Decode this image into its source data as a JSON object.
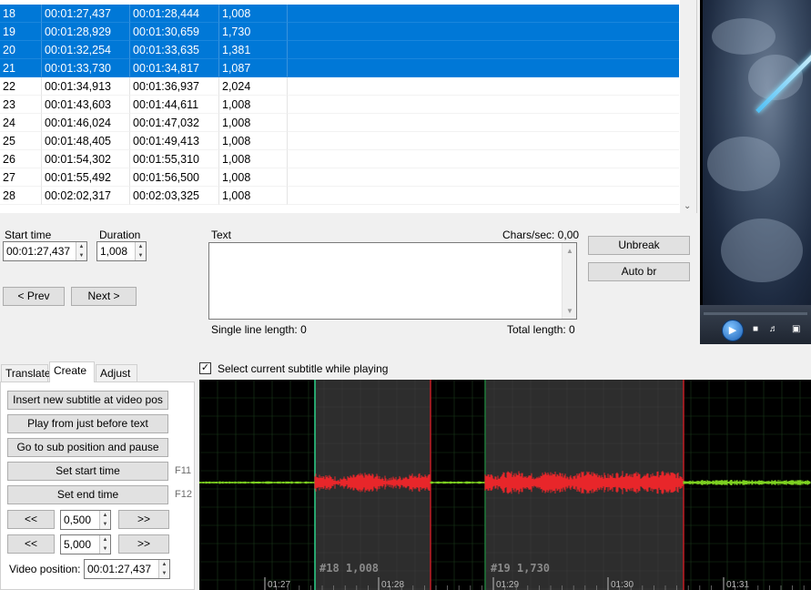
{
  "grid": {
    "rows": [
      {
        "num": "18",
        "start": "00:01:27,437",
        "end": "00:01:28,444",
        "dur": "1,008",
        "text": "",
        "selected": true
      },
      {
        "num": "19",
        "start": "00:01:28,929",
        "end": "00:01:30,659",
        "dur": "1,730",
        "text": "",
        "selected": true
      },
      {
        "num": "20",
        "start": "00:01:32,254",
        "end": "00:01:33,635",
        "dur": "1,381",
        "text": "",
        "selected": true
      },
      {
        "num": "21",
        "start": "00:01:33,730",
        "end": "00:01:34,817",
        "dur": "1,087",
        "text": "",
        "selected": true
      },
      {
        "num": "22",
        "start": "00:01:34,913",
        "end": "00:01:36,937",
        "dur": "2,024",
        "text": "",
        "selected": false
      },
      {
        "num": "23",
        "start": "00:01:43,603",
        "end": "00:01:44,611",
        "dur": "1,008",
        "text": "",
        "selected": false
      },
      {
        "num": "24",
        "start": "00:01:46,024",
        "end": "00:01:47,032",
        "dur": "1,008",
        "text": "",
        "selected": false
      },
      {
        "num": "25",
        "start": "00:01:48,405",
        "end": "00:01:49,413",
        "dur": "1,008",
        "text": "",
        "selected": false
      },
      {
        "num": "26",
        "start": "00:01:54,302",
        "end": "00:01:55,310",
        "dur": "1,008",
        "text": "",
        "selected": false
      },
      {
        "num": "27",
        "start": "00:01:55,492",
        "end": "00:01:56,500",
        "dur": "1,008",
        "text": "",
        "selected": false
      },
      {
        "num": "28",
        "start": "00:02:02,317",
        "end": "00:02:03,325",
        "dur": "1,008",
        "text": "",
        "selected": false
      }
    ]
  },
  "edit": {
    "start_time_label": "Start time",
    "start_time_value": "00:01:27,437",
    "duration_label": "Duration",
    "duration_value": "1,008",
    "text_label": "Text",
    "chars_sec": "Chars/sec: 0,00",
    "prev_label": "< Prev",
    "next_label": "Next >",
    "unbreak_label": "Unbreak",
    "auto_br_label": "Auto br",
    "single_line_length": "Single line length: 0",
    "total_length": "Total length: 0"
  },
  "tabs": {
    "items": [
      "Translate",
      "Create",
      "Adjust"
    ],
    "active": "Create"
  },
  "create": {
    "insert_label": "Insert new subtitle at video pos",
    "play_before_label": "Play from just before text",
    "goto_sub_label": "Go to sub position and pause",
    "set_start_label": "Set start time",
    "set_start_key": "F11",
    "set_end_label": "Set end time",
    "set_end_key": "F12",
    "back_label": "<<",
    "fwd_label": ">>",
    "step1_value": "0,500",
    "step2_value": "5,000",
    "video_position_label": "Video position:",
    "video_position_value": "00:01:27,437"
  },
  "waveform": {
    "select_current_label": "Select current subtitle while playing",
    "select_current_checked": true,
    "seg1_label": "#18  1,008",
    "seg2_label": "#19  1,730",
    "ticks": [
      "01:27",
      "01:28",
      "01:29",
      "01:30",
      "01:31"
    ],
    "colors": {
      "background": "#000000",
      "selected_region": "#2d2d2d",
      "wave_active": "#e8262a",
      "wave_idle": "#7ed321",
      "cursor": "#2cd38a",
      "grid": "#1e3a1e"
    }
  },
  "icons": [
    "play-icon",
    "stop-icon",
    "volume-icon",
    "fullscreen-icon",
    "checkbox-check-icon"
  ]
}
